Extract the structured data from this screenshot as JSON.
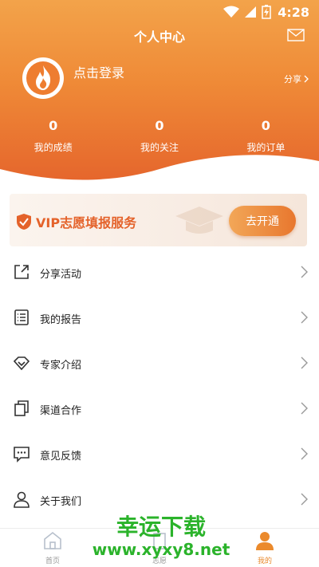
{
  "status_bar": {
    "time": "4:28"
  },
  "header": {
    "title": "个人中心",
    "login_text": "点击登录",
    "share_label": "分享"
  },
  "stats": [
    {
      "value": "0",
      "label": "我的成绩"
    },
    {
      "value": "0",
      "label": "我的关注"
    },
    {
      "value": "0",
      "label": "我的订单"
    }
  ],
  "vip": {
    "title": "VIP志愿填报服务",
    "button_label": "去开通"
  },
  "menu": [
    {
      "label": "分享活动",
      "icon": "share-icon"
    },
    {
      "label": "我的报告",
      "icon": "report-icon"
    },
    {
      "label": "专家介绍",
      "icon": "diamond-icon"
    },
    {
      "label": "渠道合作",
      "icon": "copy-icon"
    },
    {
      "label": "意见反馈",
      "icon": "feedback-icon"
    },
    {
      "label": "关于我们",
      "icon": "user-icon"
    }
  ],
  "bottom_nav": [
    {
      "label": "首页",
      "icon": "home-icon",
      "active": false
    },
    {
      "label": "志愿",
      "icon": "volunteer-icon",
      "active": false
    },
    {
      "label": "我的",
      "icon": "profile-icon",
      "active": true
    }
  ],
  "watermark": {
    "title": "幸运下载",
    "url": "www.xyxy8.net"
  },
  "colors": {
    "accent": "#e4622a",
    "header_top": "#f3a34a",
    "header_bottom": "#e5652c",
    "watermark": "#2bb32b"
  }
}
